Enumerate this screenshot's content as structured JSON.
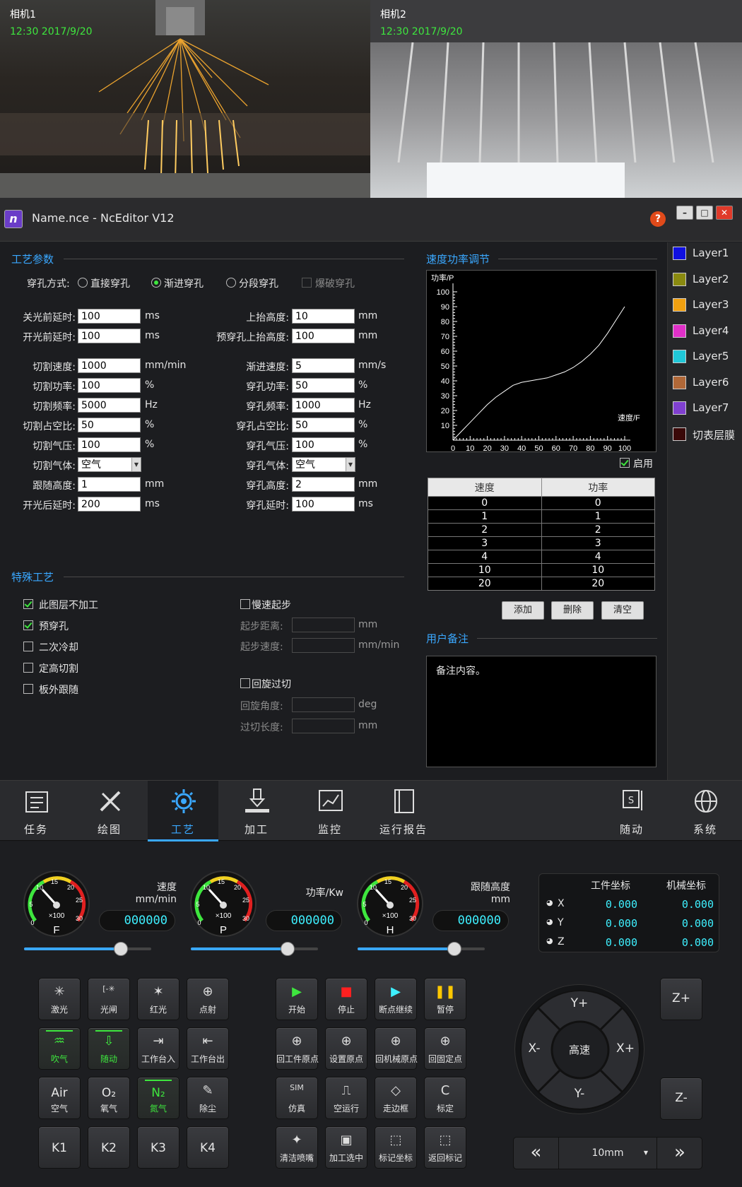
{
  "cameras": [
    {
      "label": "相机1",
      "timestamp": "12:30  2017/9/20"
    },
    {
      "label": "相机2",
      "timestamp": "12:30  2017/9/20"
    }
  ],
  "window": {
    "title": "Name.nce - NcEditor V12",
    "help": "?",
    "min": "–",
    "max": "□",
    "close": "✕"
  },
  "process": {
    "title": "工艺参数",
    "pierce_label": "穿孔方式:",
    "pierce_options": [
      "直接穿孔",
      "渐进穿孔",
      "分段穿孔",
      "爆破穿孔"
    ],
    "left": [
      {
        "label": "关光前延时:",
        "value": "100",
        "unit": "ms"
      },
      {
        "label": "开光前延时:",
        "value": "100",
        "unit": "ms"
      },
      {
        "label": "切割速度:",
        "value": "1000",
        "unit": "mm/min"
      },
      {
        "label": "切割功率:",
        "value": "100",
        "unit": "%"
      },
      {
        "label": "切割频率:",
        "value": "5000",
        "unit": "Hz"
      },
      {
        "label": "切割占空比:",
        "value": "50",
        "unit": "%"
      },
      {
        "label": "切割气压:",
        "value": "100",
        "unit": "%"
      },
      {
        "label": "切割气体:",
        "value": "空气",
        "unit": ""
      },
      {
        "label": "跟随高度:",
        "value": "1",
        "unit": "mm"
      },
      {
        "label": "开光后延时:",
        "value": "200",
        "unit": "ms"
      }
    ],
    "right": [
      {
        "label": "上抬高度:",
        "value": "10",
        "unit": "mm"
      },
      {
        "label": "预穿孔上抬高度:",
        "value": "100",
        "unit": "mm"
      },
      {
        "label": "渐进速度:",
        "value": "5",
        "unit": "mm/s"
      },
      {
        "label": "穿孔功率:",
        "value": "50",
        "unit": "%"
      },
      {
        "label": "穿孔频率:",
        "value": "1000",
        "unit": "Hz"
      },
      {
        "label": "穿孔占空比:",
        "value": "50",
        "unit": "%"
      },
      {
        "label": "穿孔气压:",
        "value": "100",
        "unit": "%"
      },
      {
        "label": "穿孔气体:",
        "value": "空气",
        "unit": ""
      },
      {
        "label": "穿孔高度:",
        "value": "2",
        "unit": "mm"
      },
      {
        "label": "穿孔延时:",
        "value": "100",
        "unit": "ms"
      }
    ]
  },
  "special": {
    "title": "特殊工艺",
    "checks": [
      {
        "label": "此图层不加工",
        "checked": true
      },
      {
        "label": "预穿孔",
        "checked": true
      },
      {
        "label": "二次冷却",
        "checked": false
      },
      {
        "label": "定高切割",
        "checked": false
      },
      {
        "label": "板外跟随",
        "checked": false
      }
    ],
    "slow_start": "慢速起步",
    "start_distance": {
      "label": "起步距离:",
      "unit": "mm"
    },
    "start_speed": {
      "label": "起步速度:",
      "unit": "mm/min"
    },
    "rotary": "回旋过切",
    "rotary_angle": {
      "label": "回旋角度:",
      "unit": "deg"
    },
    "overcut_length": {
      "label": "过切长度:",
      "unit": "mm"
    }
  },
  "speed_power": {
    "title": "速度功率调节",
    "enable": "启用",
    "add": "添加",
    "delete": "删除",
    "clear": "清空",
    "columns": [
      "速度",
      "功率"
    ],
    "rows": [
      [
        "0",
        "0"
      ],
      [
        "1",
        "1"
      ],
      [
        "2",
        "2"
      ],
      [
        "3",
        "3"
      ],
      [
        "4",
        "4"
      ],
      [
        "10",
        "10"
      ],
      [
        "20",
        "20"
      ]
    ]
  },
  "chart_data": {
    "type": "line",
    "xlabel": "速度/F",
    "ylabel": "功率/P",
    "xlim": [
      0,
      100
    ],
    "ylim": [
      0,
      100
    ],
    "x_ticks": [
      0,
      10,
      20,
      30,
      40,
      50,
      60,
      70,
      80,
      90,
      100
    ],
    "y_ticks": [
      10,
      20,
      30,
      40,
      50,
      60,
      70,
      80,
      90,
      100
    ],
    "grid": false,
    "series": [
      {
        "x": [
          0,
          5,
          10,
          15,
          20,
          25,
          30,
          35,
          40,
          45,
          50,
          55,
          60,
          65,
          70,
          75,
          80,
          85,
          90,
          95,
          100
        ],
        "y": [
          0,
          6,
          12,
          18,
          24,
          29,
          33,
          37,
          39,
          40,
          41,
          42,
          44,
          46,
          49,
          53,
          58,
          64,
          72,
          81,
          90
        ]
      }
    ]
  },
  "notes": {
    "title": "用户备注",
    "text": "备注内容。"
  },
  "layers": [
    {
      "name": "Layer1",
      "color": "#1010e0"
    },
    {
      "name": "Layer2",
      "color": "#8a8a10"
    },
    {
      "name": "Layer3",
      "color": "#f0a010"
    },
    {
      "name": "Layer4",
      "color": "#e030c8"
    },
    {
      "name": "Layer5",
      "color": "#20c8d8"
    },
    {
      "name": "Layer6",
      "color": "#b06838"
    },
    {
      "name": "Layer7",
      "color": "#8040d0"
    },
    {
      "name": "切表层膜",
      "color": "#3a0808"
    }
  ],
  "nav": [
    {
      "label": "任务",
      "icon": "task-list-icon"
    },
    {
      "label": "绘图",
      "icon": "pencil-ruler-icon"
    },
    {
      "label": "工艺",
      "icon": "gear-icon"
    },
    {
      "label": "加工",
      "icon": "laser-head-icon"
    },
    {
      "label": "监控",
      "icon": "monitor-chart-icon"
    },
    {
      "label": "运行报告",
      "icon": "report-book-icon"
    },
    {
      "label": "随动",
      "icon": "follow-icon"
    },
    {
      "label": "系统",
      "icon": "globe-icon"
    }
  ],
  "gauges": [
    {
      "label": "速度\nmm/min",
      "letter": "F",
      "value": "000000",
      "level": 0.76
    },
    {
      "label": "功率/Kw",
      "letter": "P",
      "value": "000000",
      "level": 0.76
    },
    {
      "label": "跟随高度\nmm",
      "letter": "H",
      "value": "000000",
      "level": 0.76
    }
  ],
  "gauge_ticks": [
    "0",
    "5",
    "10",
    "15",
    "20",
    "25",
    "30"
  ],
  "gauge_multiplier": "×100",
  "coords": {
    "work": "工件坐标",
    "machine": "机械坐标",
    "axes": [
      {
        "axis": "X",
        "work": "0.000",
        "machine": "0.000"
      },
      {
        "axis": "Y",
        "work": "0.000",
        "machine": "0.000"
      },
      {
        "axis": "Z",
        "work": "0.000",
        "machine": "0.000"
      }
    ]
  },
  "buttons_left": [
    {
      "label": "激光",
      "icon": "✳"
    },
    {
      "label": "光闸",
      "icon": "[-✳"
    },
    {
      "label": "红光",
      "icon": "✶"
    },
    {
      "label": "点射",
      "icon": "⊕"
    },
    {
      "label": "吹气",
      "icon": "♒",
      "lit": true
    },
    {
      "label": "随动",
      "icon": "⇩",
      "lit": true
    },
    {
      "label": "工作台入",
      "icon": "⇥"
    },
    {
      "label": "工作台出",
      "icon": "⇤"
    },
    {
      "label": "空气",
      "big": "Air"
    },
    {
      "label": "氧气",
      "big": "O₂"
    },
    {
      "label": "氮气",
      "big": "N₂",
      "lit": true
    },
    {
      "label": "除尘",
      "icon": "✎"
    },
    {
      "big": "K1"
    },
    {
      "big": "K2"
    },
    {
      "big": "K3"
    },
    {
      "big": "K4"
    }
  ],
  "buttons_mid": [
    {
      "label": "开始",
      "icon": "▶",
      "color": "#3ee63e"
    },
    {
      "label": "停止",
      "icon": "■",
      "color": "#ff2020"
    },
    {
      "label": "断点继续",
      "icon": "▶",
      "color": "#3ef0ff"
    },
    {
      "label": "暂停",
      "icon": "❚❚",
      "color": "#ffc800"
    },
    {
      "label": "回工件原点",
      "icon": "⊕"
    },
    {
      "label": "设置原点",
      "icon": "⊕"
    },
    {
      "label": "回机械原点",
      "icon": "⊕"
    },
    {
      "label": "回固定点",
      "icon": "⊕"
    },
    {
      "label": "仿真",
      "icon": "SIM"
    },
    {
      "label": "空运行",
      "icon": "⎍"
    },
    {
      "label": "走边框",
      "icon": "◇"
    },
    {
      "label": "标定",
      "icon": "C"
    },
    {
      "label": "清洁喷嘴",
      "icon": "✦"
    },
    {
      "label": "加工选中",
      "icon": "▣"
    },
    {
      "label": "标记坐标",
      "icon": "⬚"
    },
    {
      "label": "返回标记",
      "icon": "⬚"
    }
  ],
  "jog": {
    "up": "Y+",
    "down": "Y-",
    "left": "X-",
    "right": "X+",
    "center": "高速",
    "z_up": "Z+",
    "z_down": "Z-",
    "step": "10mm",
    "prev": "«",
    "next": "»"
  }
}
